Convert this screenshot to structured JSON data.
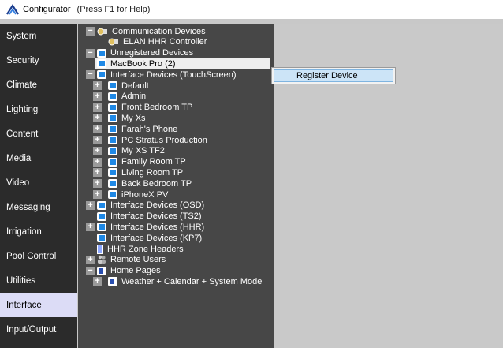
{
  "window": {
    "title": "Configurator",
    "help_hint": "(Press F1 for Help)"
  },
  "sidebar": {
    "items": [
      {
        "label": "System"
      },
      {
        "label": "Security"
      },
      {
        "label": "Climate"
      },
      {
        "label": "Lighting"
      },
      {
        "label": "Content"
      },
      {
        "label": "Media"
      },
      {
        "label": "Video"
      },
      {
        "label": "Messaging"
      },
      {
        "label": "Irrigation"
      },
      {
        "label": "Pool Control"
      },
      {
        "label": "Utilities"
      },
      {
        "label": "Interface"
      },
      {
        "label": "Input/Output"
      }
    ],
    "active": "Interface"
  },
  "tree": {
    "nodes": [
      {
        "label": "Communication Devices",
        "icon": "gear-icon",
        "expander": "minus",
        "selected": false
      },
      {
        "label": "ELAN HHR Controller",
        "icon": "gear-icon",
        "expander": "none",
        "selected": false
      },
      {
        "label": "Unregistered Devices",
        "icon": "device-icon",
        "expander": "minus",
        "selected": false
      },
      {
        "label": "MacBook Pro (2)",
        "icon": "device-icon",
        "expander": "none",
        "selected": true
      },
      {
        "label": "Interface Devices (TouchScreen)",
        "icon": "device-icon",
        "expander": "minus",
        "selected": false
      },
      {
        "label": "Default",
        "icon": "device-icon",
        "expander": "plus",
        "selected": false
      },
      {
        "label": "Admin",
        "icon": "device-icon",
        "expander": "plus",
        "selected": false
      },
      {
        "label": "Front Bedroom TP",
        "icon": "device-icon",
        "expander": "plus",
        "selected": false
      },
      {
        "label": "My Xs",
        "icon": "device-icon",
        "expander": "plus",
        "selected": false
      },
      {
        "label": "Farah's Phone",
        "icon": "device-icon",
        "expander": "plus",
        "selected": false
      },
      {
        "label": "PC Stratus Production",
        "icon": "device-icon",
        "expander": "plus",
        "selected": false
      },
      {
        "label": "My XS TF2",
        "icon": "device-icon",
        "expander": "plus",
        "selected": false
      },
      {
        "label": "Family Room TP",
        "icon": "device-icon",
        "expander": "plus",
        "selected": false
      },
      {
        "label": "Living Room TP",
        "icon": "device-icon",
        "expander": "plus",
        "selected": false
      },
      {
        "label": "Back Bedroom TP",
        "icon": "device-icon",
        "expander": "plus",
        "selected": false
      },
      {
        "label": "iPhoneX PV",
        "icon": "device-icon",
        "expander": "plus",
        "selected": false
      },
      {
        "label": "Interface Devices (OSD)",
        "icon": "device-icon",
        "expander": "plus",
        "selected": false
      },
      {
        "label": "Interface Devices (TS2)",
        "icon": "device-icon",
        "expander": "none",
        "selected": false
      },
      {
        "label": "Interface Devices (HHR)",
        "icon": "device-icon",
        "expander": "plus",
        "selected": false
      },
      {
        "label": "Interface Devices (KP7)",
        "icon": "device-icon",
        "expander": "none",
        "selected": false
      },
      {
        "label": "HHR Zone Headers",
        "icon": "zone-icon",
        "expander": "none",
        "selected": false
      },
      {
        "label": "Remote Users",
        "icon": "users-icon",
        "expander": "plus",
        "selected": false
      },
      {
        "label": "Home Pages",
        "icon": "page-icon",
        "expander": "minus",
        "selected": false
      },
      {
        "label": "Weather + Calendar + System Mode",
        "icon": "page-icon",
        "expander": "plus",
        "selected": false
      }
    ]
  },
  "context_menu": {
    "items": [
      {
        "label": "Register Device"
      }
    ]
  }
}
